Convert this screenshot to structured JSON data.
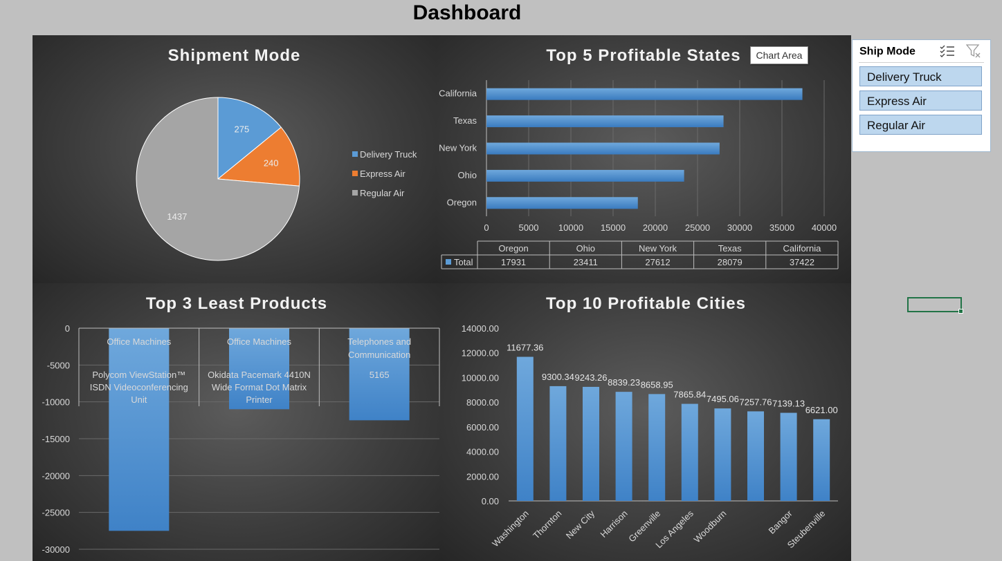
{
  "page_title": "Dashboard",
  "chart_area_tooltip": "Chart Area",
  "slicer": {
    "title": "Ship Mode",
    "items": [
      "Delivery Truck",
      "Express Air",
      "Regular Air"
    ],
    "icons": [
      "multi-select-icon",
      "clear-filter-icon"
    ]
  },
  "colors": {
    "blue": "#5b9bd5",
    "orange": "#ed7d31",
    "gray": "#a5a5a5",
    "text": "#d9d9d9"
  },
  "chart_data": [
    {
      "type": "pie",
      "title": "Shipment Mode",
      "categories": [
        "Delivery Truck",
        "Express Air",
        "Regular Air"
      ],
      "values": [
        275,
        240,
        1437
      ],
      "legend": "right"
    },
    {
      "type": "bar",
      "orientation": "horizontal",
      "title": "Top 5 Profitable States",
      "categories": [
        "California",
        "Texas",
        "New York",
        "Ohio",
        "Oregon"
      ],
      "values": [
        37422,
        28079,
        27612,
        23411,
        17931
      ],
      "xlim": [
        0,
        40000
      ],
      "xticks": [
        "0",
        "5000",
        "10000",
        "15000",
        "20000",
        "25000",
        "30000",
        "35000",
        "40000"
      ],
      "grid": true,
      "data_table": {
        "columns": [
          "Oregon",
          "Ohio",
          "New York",
          "Texas",
          "California"
        ],
        "row_label": "Total",
        "values": [
          "17931",
          "23411",
          "27612",
          "28079",
          "37422"
        ]
      }
    },
    {
      "type": "bar",
      "title": "Top 3 Least Products",
      "values": [
        -27500,
        -11000,
        -12500
      ],
      "ylim": [
        -30000,
        0
      ],
      "yticks": [
        "0",
        "-5000",
        "-10000",
        "-15000",
        "-20000",
        "-25000",
        "-30000"
      ],
      "categories_top": [
        "Office Machines",
        "Office Machines",
        "Telephones and Communication"
      ],
      "categories_sub": [
        "Polycom ViewStation™ ISDN Videoconferencing Unit",
        "Okidata Pacemark 4410N Wide Format Dot Matrix Printer",
        "5165"
      ],
      "grid": true
    },
    {
      "type": "bar",
      "title": "Top 10 Profitable Cities",
      "categories": [
        "Washington",
        "Thornton",
        "New City",
        "Harrison",
        "Greenville",
        "Los Angeles",
        "Woodburn",
        "",
        "Bangor",
        "Steubenville"
      ],
      "values": [
        11677.36,
        9300.34,
        9243.26,
        8839.23,
        8658.95,
        7865.84,
        7495.06,
        7257.76,
        7139.13,
        6621.0
      ],
      "data_labels": [
        "11677.36",
        "9300.34",
        "9243.26",
        "8839.23",
        "8658.95",
        "7865.84",
        "7495.06",
        "7257.76",
        "7139.13",
        "6621.00"
      ],
      "ylim": [
        0,
        14000
      ],
      "yticks": [
        "0.00",
        "2000.00",
        "4000.00",
        "6000.00",
        "8000.00",
        "10000.00",
        "12000.00",
        "14000.00"
      ],
      "grid": false
    }
  ]
}
